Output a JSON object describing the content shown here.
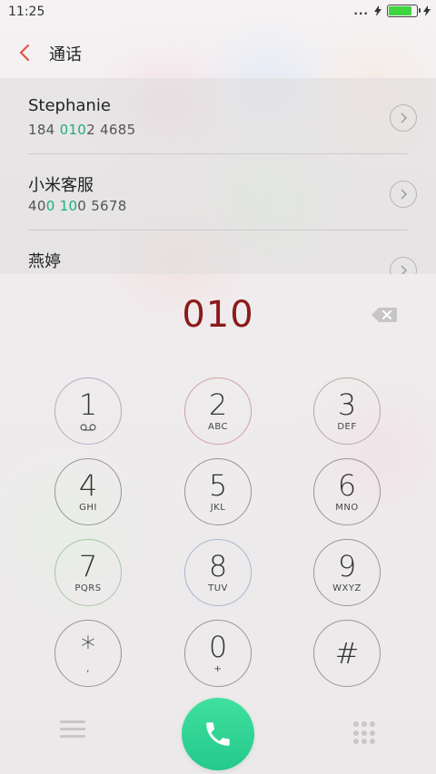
{
  "status_bar": {
    "time": "11:25",
    "dots": "...",
    "battery_level": 0.85,
    "battery_color": "#3fd53f"
  },
  "header": {
    "back_icon": "chevron-left-icon",
    "title": "通话",
    "accent_color": "#e84b3c"
  },
  "contacts": [
    {
      "name": "Stephanie",
      "number_parts": [
        "184 ",
        "010",
        "2  4685"
      ]
    },
    {
      "name": "小米客服",
      "number_parts": [
        "40",
        "0  10",
        "0  5678"
      ]
    },
    {
      "name": "燕婷",
      "number_parts": [
        "",
        "",
        ""
      ]
    }
  ],
  "display": {
    "typed_number": "010",
    "typed_color": "#8b1a1a",
    "highlight_color": "#1fae7a",
    "backspace_icon": "backspace-icon"
  },
  "keypad": [
    {
      "digit": "1",
      "letters": "",
      "icon": "voicemail-icon"
    },
    {
      "digit": "2",
      "letters": "ABC"
    },
    {
      "digit": "3",
      "letters": "DEF"
    },
    {
      "digit": "4",
      "letters": "GHI"
    },
    {
      "digit": "5",
      "letters": "JKL"
    },
    {
      "digit": "6",
      "letters": "MNO"
    },
    {
      "digit": "7",
      "letters": "PQRS"
    },
    {
      "digit": "8",
      "letters": "TUV"
    },
    {
      "digit": "9",
      "letters": "WXYZ"
    },
    {
      "digit": "*",
      "letters": ","
    },
    {
      "digit": "0",
      "letters": "+"
    },
    {
      "digit": "#",
      "letters": ""
    }
  ],
  "bottom_bar": {
    "menu_icon": "menu-icon",
    "call_icon": "phone-icon",
    "call_color": "#2fd394",
    "dialpad_icon": "dialpad-icon"
  }
}
